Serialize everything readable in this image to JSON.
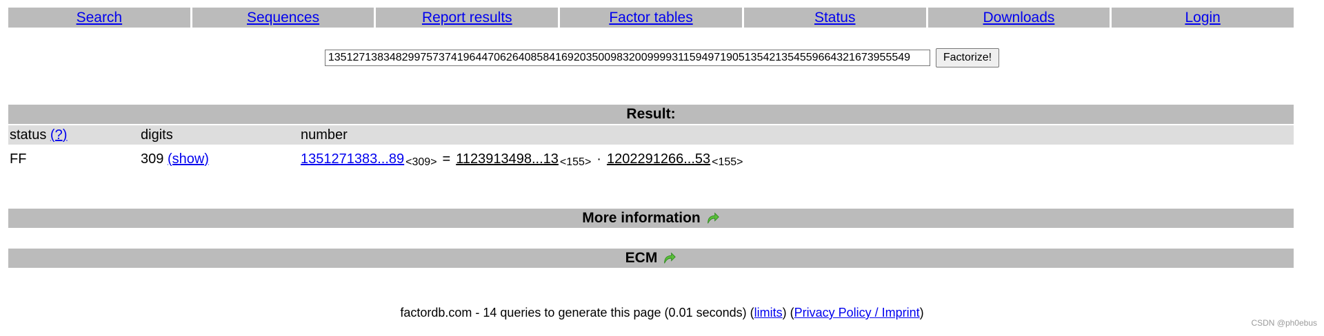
{
  "nav": {
    "items": [
      {
        "label": "Search"
      },
      {
        "label": "Sequences"
      },
      {
        "label": "Report results"
      },
      {
        "label": "Factor tables"
      },
      {
        "label": "Status"
      },
      {
        "label": "Downloads"
      },
      {
        "label": "Login"
      }
    ]
  },
  "search": {
    "value": "13512713834829975737419644706264085841692035009832009999311594971905135421354559664321673955549",
    "button_label": "Factorize!"
  },
  "result": {
    "title": "Result:",
    "headers": {
      "status": "status",
      "status_help": "(?)",
      "digits": "digits",
      "number": "number"
    },
    "row": {
      "status": "FF",
      "digits": "309",
      "show": "(show)",
      "number": "1351271383...89",
      "number_digits": "<309>",
      "equals": "=",
      "factor1": "1123913498...13",
      "factor1_digits": "<155>",
      "times": "·",
      "factor2": "1202291266...53",
      "factor2_digits": "<155>"
    }
  },
  "more_info": {
    "label": "More information",
    "icon": "green-arrow-icon"
  },
  "ecm": {
    "label": "ECM",
    "icon": "green-arrow-icon"
  },
  "footer": {
    "text_prefix": "factordb.com - 14 queries to generate this page (0.01 seconds) (",
    "limits": "limits",
    "text_mid": ") (",
    "privacy": "Privacy Policy / Imprint",
    "text_suffix": ")"
  },
  "watermark": "CSDN @ph0ebus",
  "colors": {
    "bar": "#bbbbbb",
    "header_row": "#dddddd",
    "link": "#0000ee",
    "arrow": "#5bbf3a"
  }
}
